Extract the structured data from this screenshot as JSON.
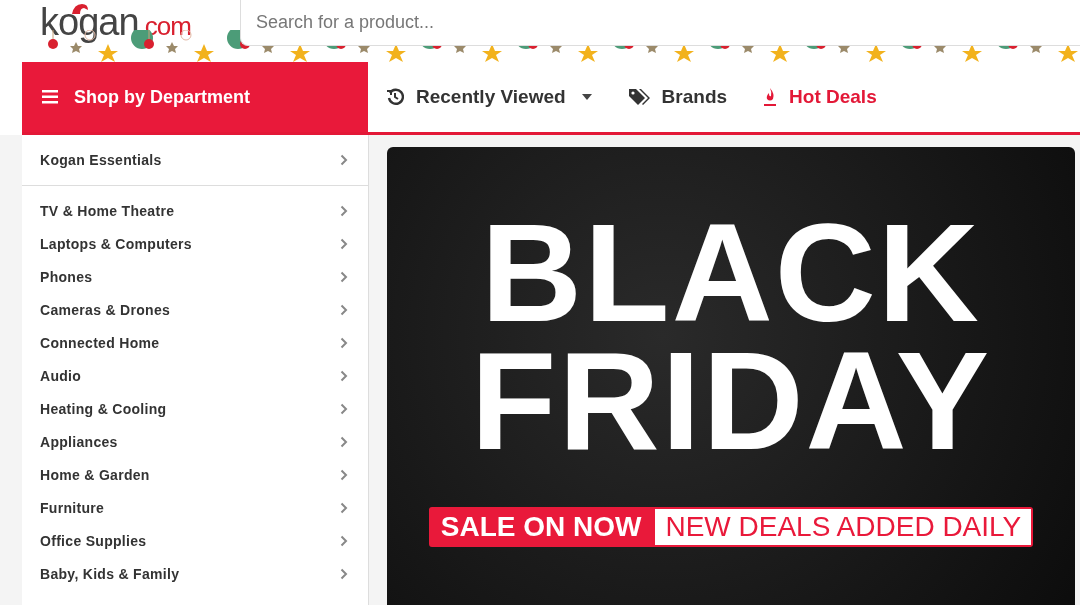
{
  "logo": {
    "name": "kogan",
    "suffix": ".com"
  },
  "search": {
    "placeholder": "Search for a product..."
  },
  "department_button": {
    "label": "Shop by Department"
  },
  "nav": [
    {
      "kind": "history",
      "label": "Recently Viewed",
      "dropdown": true,
      "selected": false
    },
    {
      "kind": "tag",
      "label": "Brands",
      "dropdown": false,
      "selected": false
    },
    {
      "kind": "fire",
      "label": "Hot Deals",
      "dropdown": false,
      "selected": true
    }
  ],
  "sidebar": {
    "top_item": "Kogan Essentials",
    "items": [
      "TV & Home Theatre",
      "Laptops & Computers",
      "Phones",
      "Cameras & Drones",
      "Connected Home",
      "Audio",
      "Heating & Cooling",
      "Appliances",
      "Home & Garden",
      "Furniture",
      "Office Supplies",
      "Baby, Kids & Family"
    ]
  },
  "banner": {
    "lines": [
      "BLACK",
      "FRIDAY"
    ],
    "tag": "SALE ON NOW",
    "tagline": "NEW DEALS ADDED DAILY"
  }
}
